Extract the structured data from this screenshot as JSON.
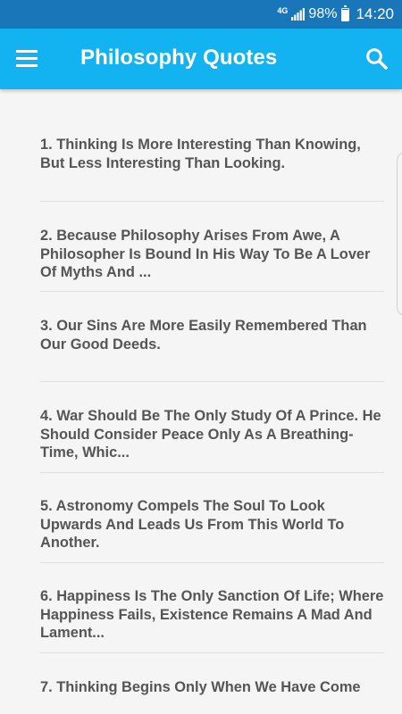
{
  "status_bar": {
    "network": "4G",
    "battery": "98%",
    "battery_level": 0.98,
    "time": "14:20"
  },
  "app_bar": {
    "title": "Philosophy Quotes",
    "menu_icon": "hamburger-menu-icon",
    "search_icon": "search-icon"
  },
  "colors": {
    "status_bar": "#1976b9",
    "app_bar": "#13b3f2",
    "background": "#f5f5f5",
    "quote_text": "#555555",
    "divider": "#dedede"
  },
  "quotes": [
    {
      "text": "1. Thinking Is More Interesting Than Knowing, But Less Interesting Than Looking."
    },
    {
      "text": "2. Because Philosophy Arises From Awe, A Philosopher Is Bound In His Way To Be A Lover Of Myths And ..."
    },
    {
      "text": "3. Our Sins Are More Easily Remembered Than Our Good Deeds."
    },
    {
      "text": "4. War Should Be The Only Study Of A Prince. He Should Consider Peace Only As A Breathing-Time, Whic..."
    },
    {
      "text": "5. Astronomy Compels The Soul To Look Upwards And Leads Us From This World To Another."
    },
    {
      "text": "6. Happiness Is The Only Sanction Of Life; Where Happiness Fails, Existence Remains A Mad And Lament..."
    },
    {
      "text": "7. Thinking Begins Only When We Have Come"
    }
  ]
}
